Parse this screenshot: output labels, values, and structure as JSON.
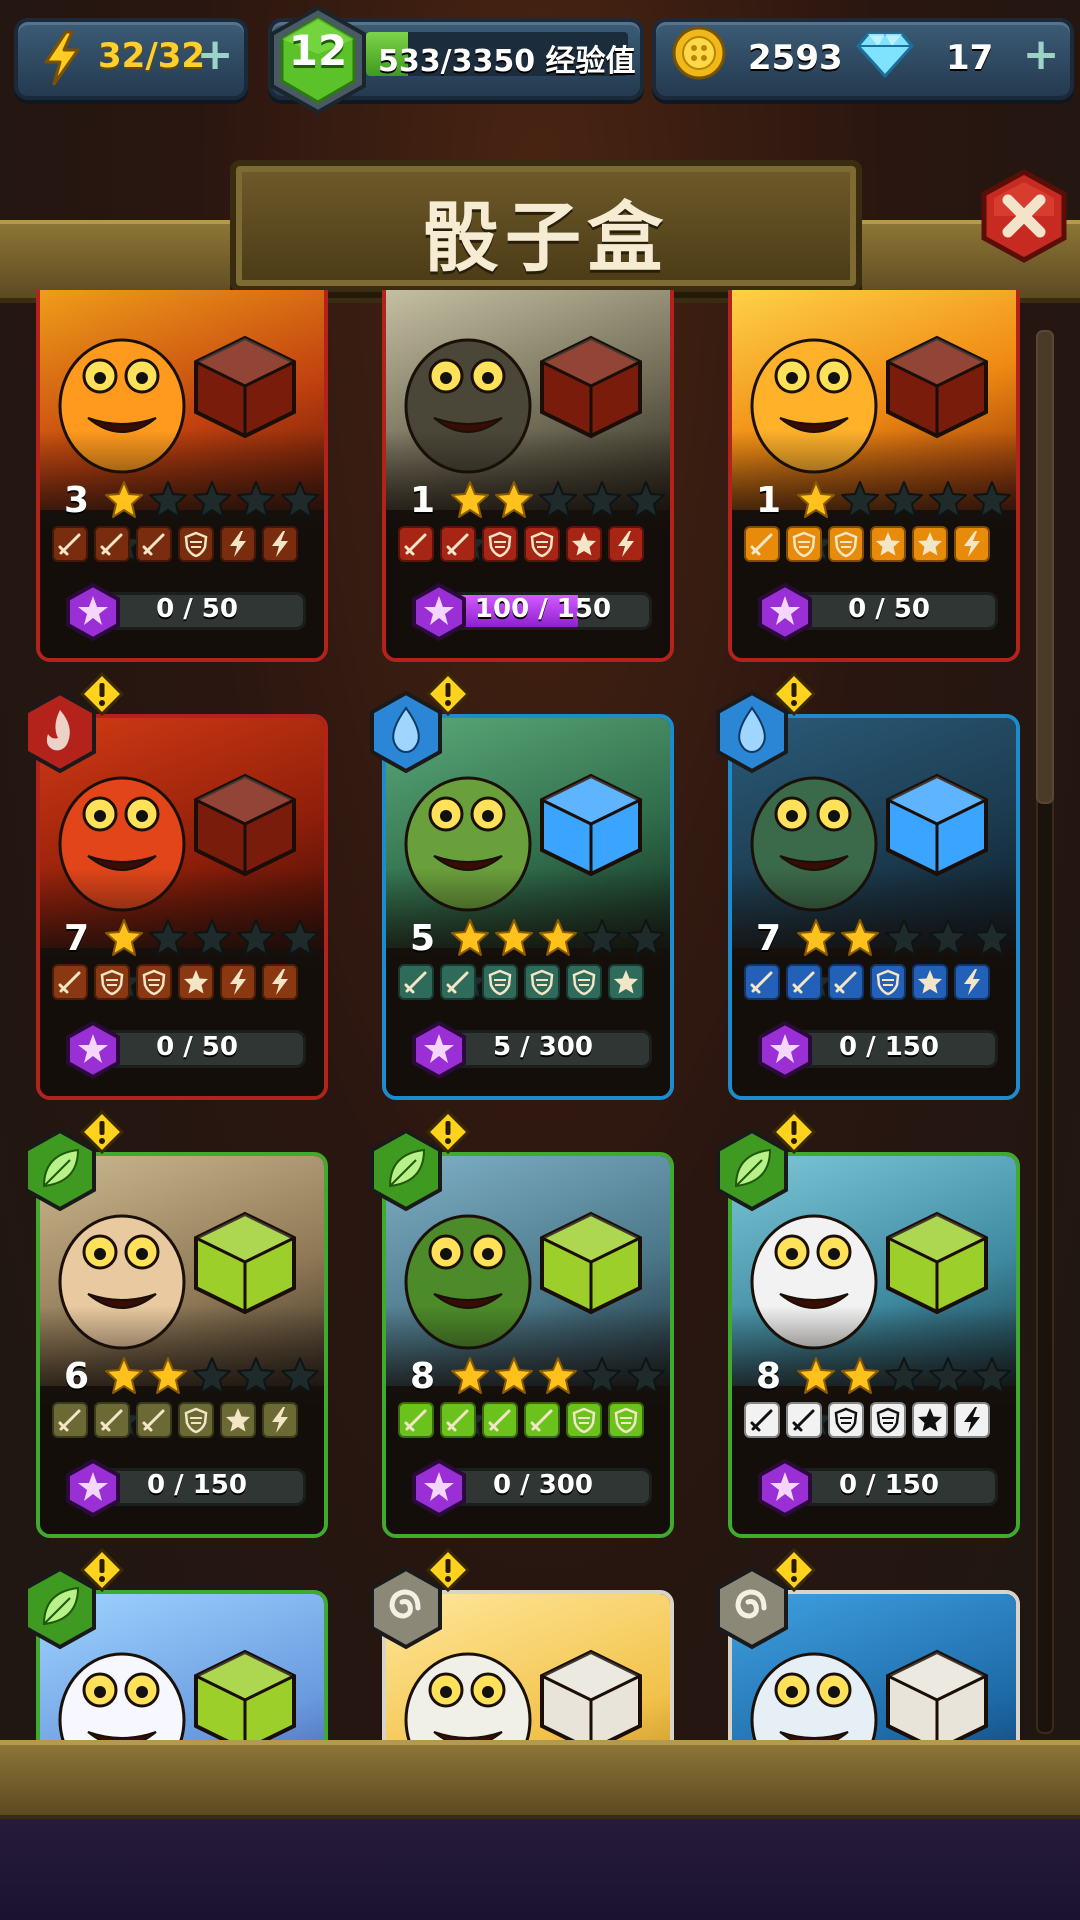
{
  "topbar": {
    "energy": "32/32",
    "level": "12",
    "xp_text": "533/3350 经验值",
    "xp_fraction": 0.16,
    "coins": "2593",
    "gems": "17",
    "icons": [
      "lightning-icon",
      "plus-icon",
      "level-hexagon-icon",
      "coin-icon",
      "diamond-icon",
      "plus-icon"
    ]
  },
  "title": "骰子盒",
  "colors": {
    "fire": "#b3231b",
    "water": "#1d8ccf",
    "earth": "#3faa2c",
    "neutral": "#d9d4c8",
    "progress": "#b03cf0",
    "star_on": "#ffc21c",
    "star_off": "#1f2a2a"
  },
  "cards": [
    {
      "element": "fire",
      "creature": "flame-monster",
      "level": "3",
      "stars": 1,
      "max_stars": 6,
      "faces": [
        "sword",
        "sword",
        "sword",
        "shield",
        "bolt",
        "bolt"
      ],
      "face_color": "#7a2c0f",
      "progress_text": "0 / 50",
      "progress": 0.0,
      "alert": false
    },
    {
      "element": "fire",
      "creature": "werewolf",
      "level": "1",
      "stars": 2,
      "max_stars": 6,
      "faces": [
        "sword",
        "sword",
        "shield",
        "shield",
        "star",
        "bolt"
      ],
      "face_color": "#a62515",
      "progress_text": "100 / 150",
      "progress": 0.667,
      "alert": false
    },
    {
      "element": "fire",
      "creature": "phoenix",
      "level": "1",
      "stars": 1,
      "max_stars": 6,
      "faces": [
        "sword",
        "shield",
        "shield",
        "star",
        "star",
        "bolt"
      ],
      "face_color": "#e98b0a",
      "progress_text": "0 / 50",
      "progress": 0.0,
      "alert": false
    },
    {
      "element": "fire",
      "creature": "lava-crab",
      "level": "7",
      "stars": 1,
      "max_stars": 6,
      "faces": [
        "sword",
        "shield",
        "shield",
        "star",
        "bolt",
        "bolt"
      ],
      "face_color": "#8a3812",
      "progress_text": "0 / 50",
      "progress": 0.0,
      "alert": true
    },
    {
      "element": "water",
      "creature": "frog-king",
      "level": "5",
      "stars": 3,
      "max_stars": 6,
      "faces": [
        "sword",
        "sword",
        "shield",
        "shield",
        "shield",
        "star"
      ],
      "face_color": "#2f6b5a",
      "progress_text": "5 / 300",
      "progress": 0.017,
      "alert": true
    },
    {
      "element": "water",
      "creature": "crocodile",
      "level": "7",
      "stars": 2,
      "max_stars": 6,
      "faces": [
        "sword",
        "sword",
        "sword",
        "shield",
        "star",
        "bolt"
      ],
      "face_color": "#2360b8",
      "progress_text": "0 / 150",
      "progress": 0.0,
      "alert": true
    },
    {
      "element": "earth",
      "creature": "cyclops-dwarf",
      "level": "6",
      "stars": 2,
      "max_stars": 6,
      "faces": [
        "sword",
        "sword",
        "sword",
        "shield",
        "star",
        "bolt"
      ],
      "face_color": "#6b6a34",
      "progress_text": "0 / 150",
      "progress": 0.0,
      "alert": true
    },
    {
      "element": "earth",
      "creature": "orc-warrior",
      "level": "8",
      "stars": 3,
      "max_stars": 6,
      "faces": [
        "sword",
        "sword",
        "sword",
        "sword",
        "shield",
        "shield"
      ],
      "face_color": "#6cc21c",
      "progress_text": "0 / 300",
      "progress": 0.0,
      "alert": true
    },
    {
      "element": "earth",
      "creature": "panda",
      "level": "8",
      "stars": 2,
      "max_stars": 6,
      "faces": [
        "sword",
        "sword",
        "shield",
        "shield",
        "star",
        "bolt"
      ],
      "face_color": "#f2f2f2",
      "progress_text": "0 / 150",
      "progress": 0.0,
      "alert": true
    },
    {
      "element": "earth",
      "creature": "unicorn",
      "alert": true
    },
    {
      "element": "neutral",
      "creature": "owl-beast",
      "alert": true
    },
    {
      "element": "neutral",
      "creature": "yeti",
      "alert": true
    }
  ]
}
